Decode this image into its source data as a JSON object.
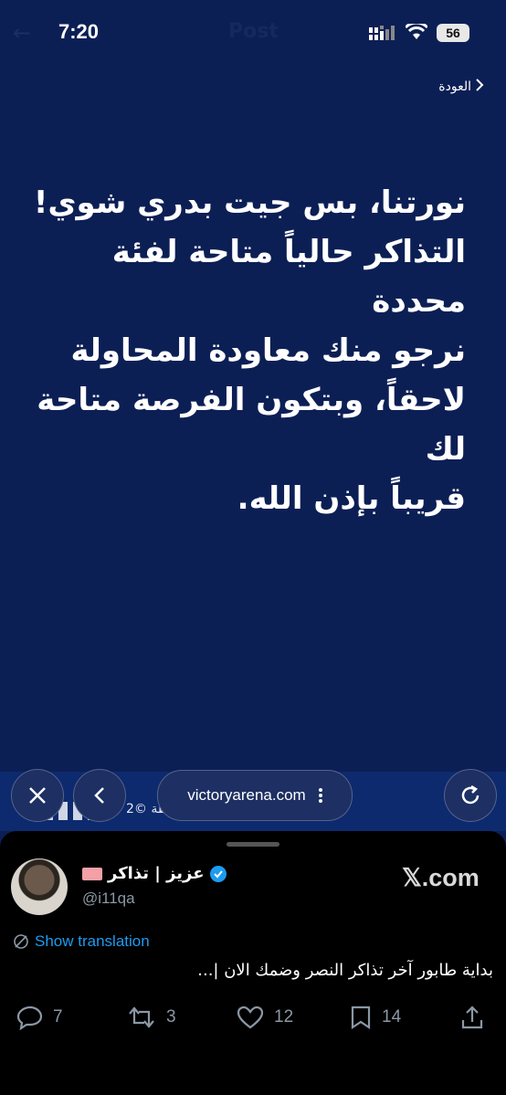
{
  "status_bar": {
    "time": "7:20",
    "battery": "56",
    "ghost_title": "Post"
  },
  "page": {
    "back_label": "العودة",
    "message_lines": [
      "نورتنا، بس جيت بدري شوي!",
      "التذاكر حالياً متاحة لفئة محددة",
      "نرجو منك معاودة المحاولة",
      "لاحقاً، وبتكون الفرصة متاحة لك",
      "قريباً بإذن الله."
    ],
    "footer_text": "2© الأول بارك واسطة"
  },
  "browser": {
    "url": "victoryarena.com"
  },
  "tweet": {
    "author_name": "عزيز | تذاكر",
    "handle": "@i11qa",
    "site": "𝕏.com",
    "translate_label": "Show translation",
    "text": "بداية طابور آخر تذاكر النصر وضمك الان |...",
    "replies": "7",
    "retweets": "3",
    "likes": "12",
    "bookmarks": "14"
  },
  "colors": {
    "page_bg": "#0c1f55",
    "link": "#1d9bf0",
    "muted": "#8b98a5",
    "verified": "#1d9bf0"
  }
}
